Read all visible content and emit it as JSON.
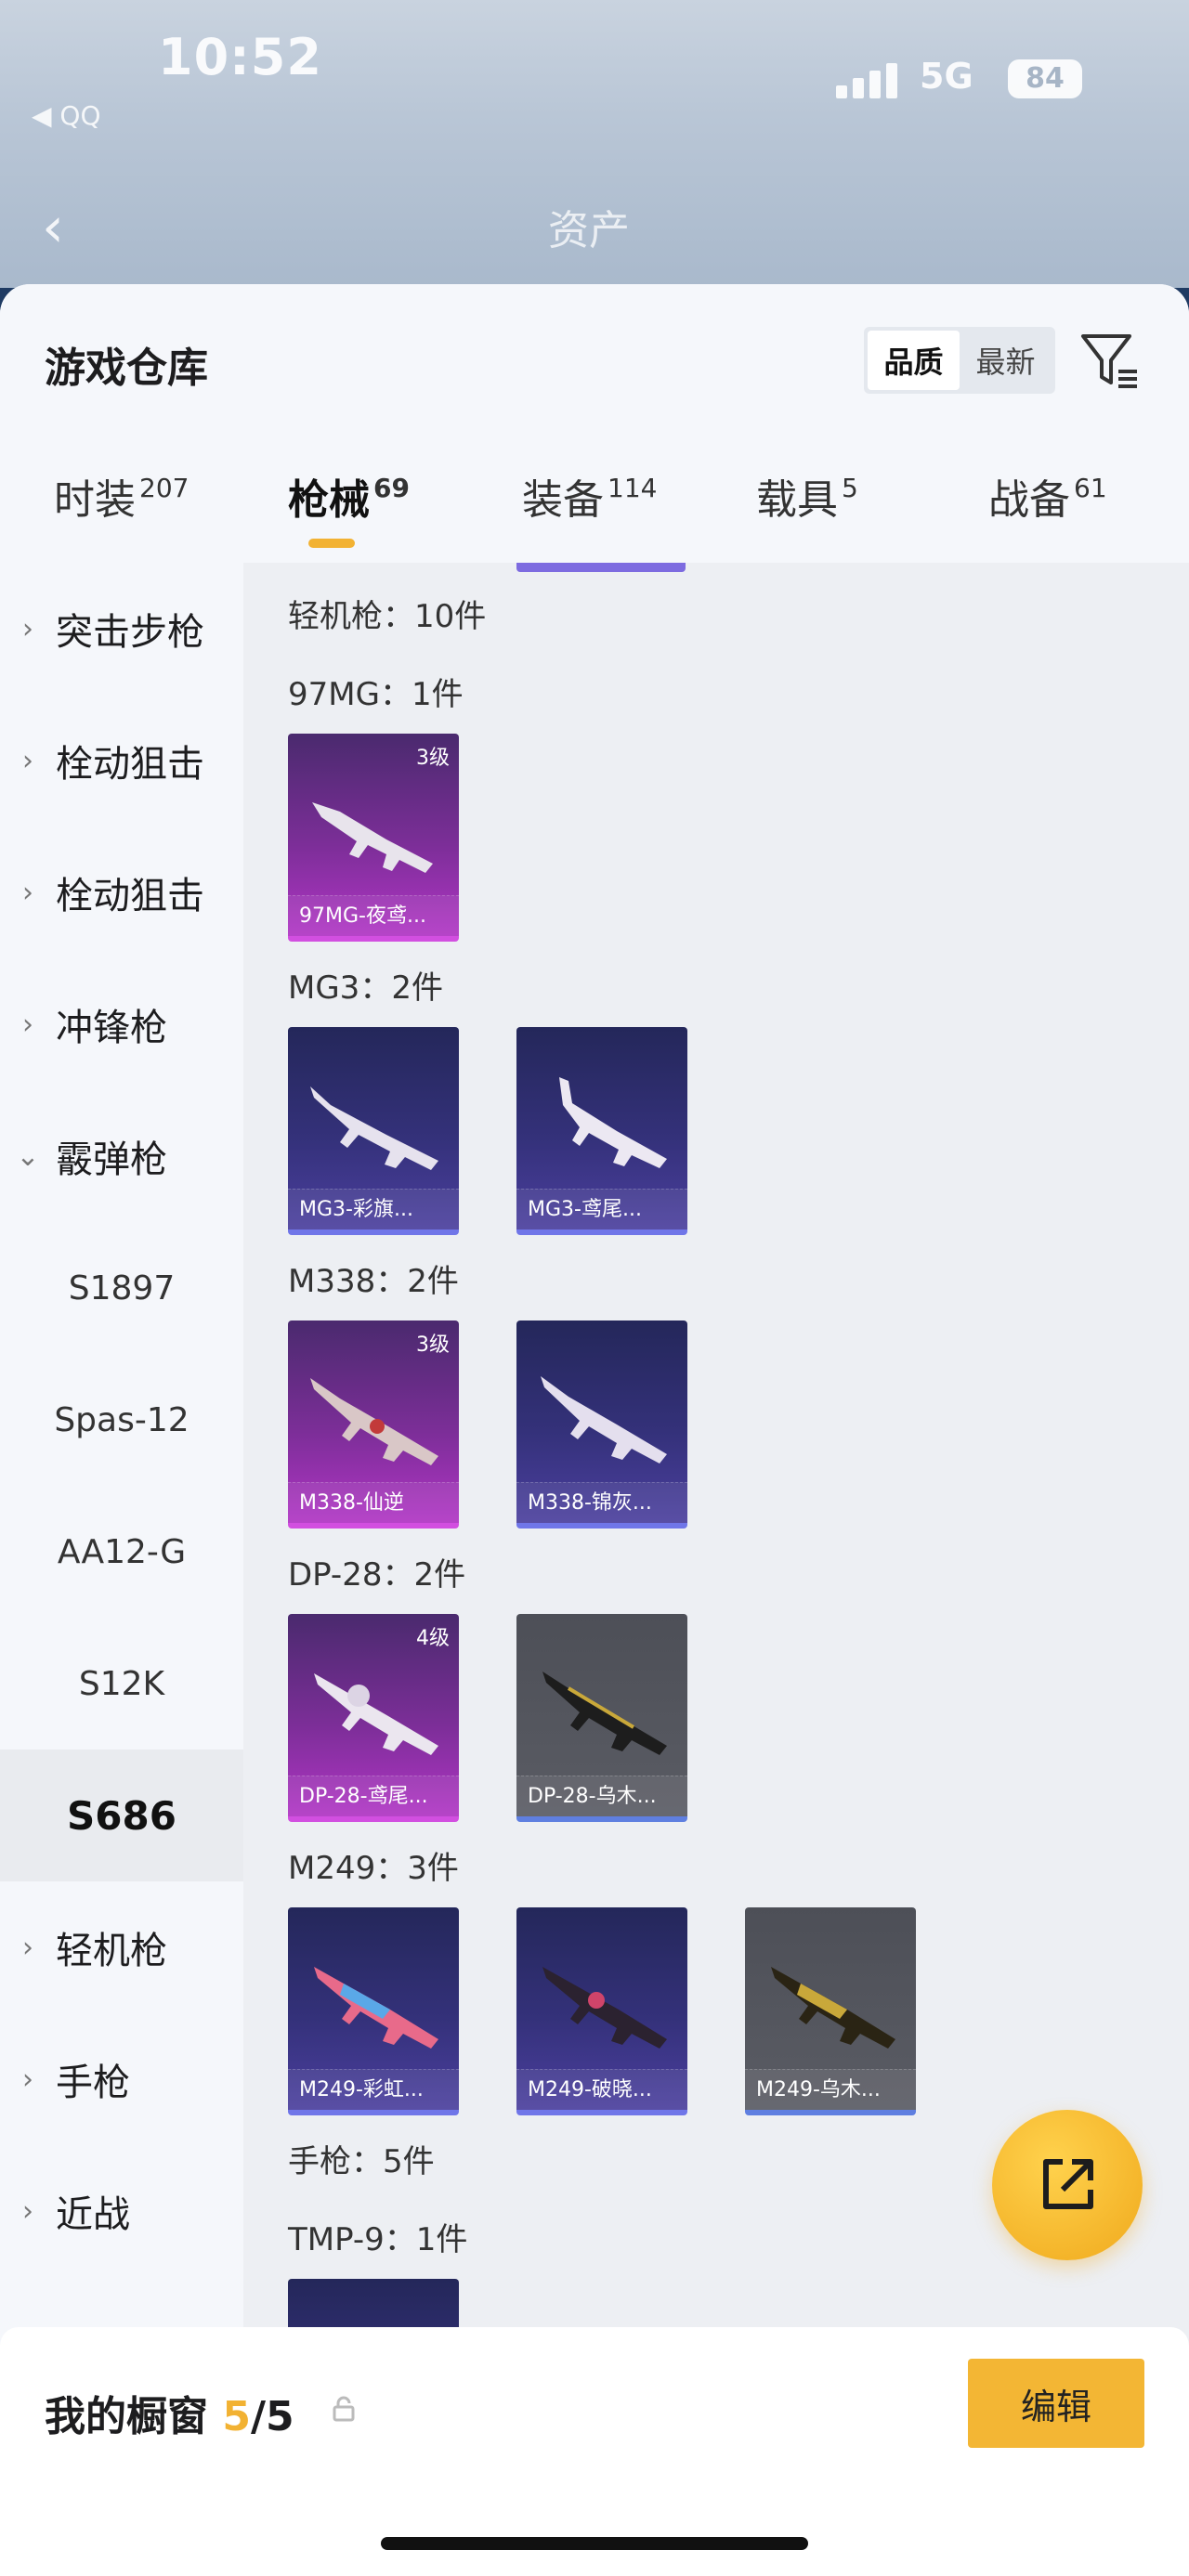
{
  "status": {
    "time": "10:52",
    "carrier": "◀ QQ",
    "network": "5G",
    "battery": "84"
  },
  "nav": {
    "back": "‹",
    "title": "资产"
  },
  "sheet": {
    "title": "游戏仓库",
    "sort": {
      "options": [
        "品质",
        "最新"
      ],
      "active": "品质"
    },
    "tabs": [
      {
        "label": "时装",
        "count": "207"
      },
      {
        "label": "枪械",
        "count": "69"
      },
      {
        "label": "装备",
        "count": "114"
      },
      {
        "label": "载具",
        "count": "5"
      },
      {
        "label": "战备",
        "count": "61"
      }
    ],
    "active_tab": "枪械"
  },
  "sidebar": {
    "items": [
      {
        "label": "突击步枪",
        "chevron": "›"
      },
      {
        "label": "栓动狙击",
        "chevron": "›"
      },
      {
        "label": "栓动狙击",
        "chevron": "›"
      },
      {
        "label": "冲锋枪",
        "chevron": "›"
      },
      {
        "label": "霰弹枪",
        "chevron": "⌄"
      },
      {
        "label": "S1897"
      },
      {
        "label": "Spas-12"
      },
      {
        "label": "AA12-G"
      },
      {
        "label": "S12K"
      },
      {
        "label": "S686"
      },
      {
        "label": "轻机枪",
        "chevron": "›"
      },
      {
        "label": "手枪",
        "chevron": "›"
      },
      {
        "label": "近战",
        "chevron": "›"
      }
    ],
    "selected": "S686"
  },
  "content": {
    "headings": [
      "轻机枪：10件",
      "97MG：1件",
      "MG3：2件",
      "M338：2件",
      "DP-28：2件",
      "M249：3件",
      "手枪：5件",
      "TMP-9：1件"
    ],
    "cards": [
      {
        "label": "97MG-夜鸢...",
        "level": "3级",
        "tier": "purple"
      },
      {
        "label": "MG3-彩旗...",
        "level": "",
        "tier": "blue"
      },
      {
        "label": "MG3-鸢尾...",
        "level": "",
        "tier": "blue"
      },
      {
        "label": "M338-仙逆",
        "level": "3级",
        "tier": "purple"
      },
      {
        "label": "M338-锦灰...",
        "level": "",
        "tier": "blue"
      },
      {
        "label": "DP-28-鸢尾...",
        "level": "4级",
        "tier": "purple"
      },
      {
        "label": "DP-28-乌木...",
        "level": "",
        "tier": "gray"
      },
      {
        "label": "M249-彩虹...",
        "level": "",
        "tier": "blue"
      },
      {
        "label": "M249-破晓...",
        "level": "",
        "tier": "blue"
      },
      {
        "label": "M249-乌木...",
        "level": "",
        "tier": "gray"
      }
    ]
  },
  "footer": {
    "title": "我的橱窗",
    "count": "5",
    "total": "/5",
    "edit_label": "编辑"
  },
  "colors": {
    "accent": "#f2b233",
    "purple_tier": "#d24fe0",
    "blue_tier": "#7076e8"
  }
}
